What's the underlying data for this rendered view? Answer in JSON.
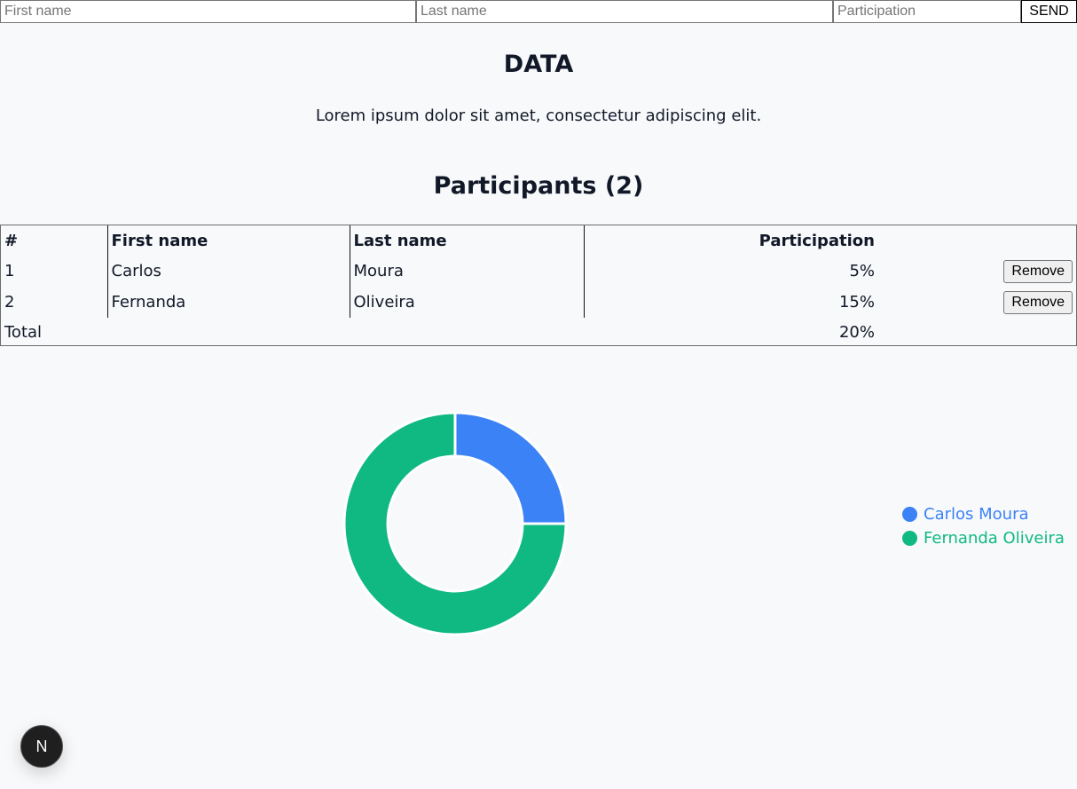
{
  "form": {
    "first_name_placeholder": "First name",
    "last_name_placeholder": "Last name",
    "participation_placeholder": "Participation",
    "send_label": "SEND"
  },
  "header": {
    "title": "DATA",
    "description": "Lorem ipsum dolor sit amet, consectetur adipiscing elit."
  },
  "participants": {
    "heading": "Participants (2)",
    "columns": [
      "#",
      "First name",
      "Last name",
      "Participation"
    ],
    "rows": [
      {
        "index": "1",
        "first_name": "Carlos",
        "last_name": "Moura",
        "participation": "5%",
        "action": "Remove"
      },
      {
        "index": "2",
        "first_name": "Fernanda",
        "last_name": "Oliveira",
        "participation": "15%",
        "action": "Remove"
      }
    ],
    "total_label": "Total",
    "total_value": "20%"
  },
  "chart_data": {
    "type": "pie",
    "categories": [
      "Carlos Moura",
      "Fernanda Oliveira"
    ],
    "values": [
      5,
      15
    ],
    "colors": [
      "#3b82f6",
      "#10b981"
    ],
    "donut": true,
    "legend": "right"
  },
  "badge": {
    "label": "N",
    "icon": "nextjs-logo-icon"
  }
}
